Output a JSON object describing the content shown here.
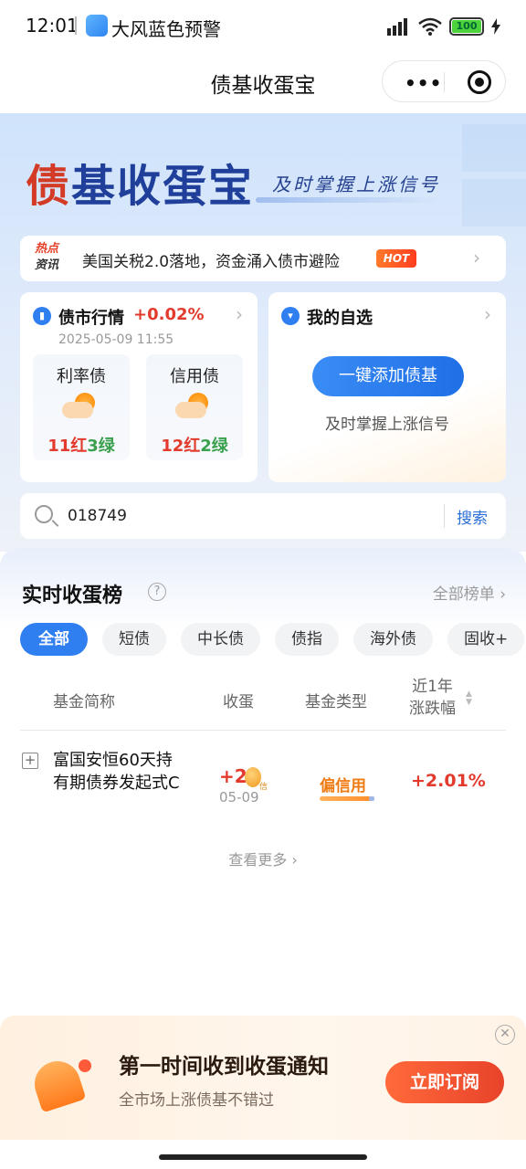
{
  "status_bar": {
    "time": "12:01",
    "app_label": "大风蓝色预警",
    "battery": "100"
  },
  "nav": {
    "title": "债基收蛋宝",
    "more_icon": "ellipsis-icon",
    "close_icon": "target-icon"
  },
  "banner": {
    "brand_title_a": "债",
    "brand_title_b": "基收蛋宝",
    "slogan": "及时掌握上涨信号"
  },
  "news": {
    "tag_line1": "热点",
    "tag_line2": "资讯",
    "text": "美国关税2.0落地，资金涌入债市避险",
    "hot_label": "HOT"
  },
  "market_card": {
    "title": "债市行情",
    "change": "+0.02%",
    "time": "2025-05-09 11:55",
    "rate": {
      "label": "利率债",
      "red": "11红",
      "green": "3绿"
    },
    "credit": {
      "label": "信用债",
      "red": "12红",
      "green": "2绿"
    }
  },
  "watch_card": {
    "title": "我的自选",
    "add_button": "一键添加债基",
    "subtitle": "及时掌握上涨信号"
  },
  "search": {
    "value": "018749",
    "button": "搜索"
  },
  "ranking": {
    "title": "实时收蛋榜",
    "all_link": "全部榜单",
    "tabs": [
      "全部",
      "短债",
      "中长债",
      "债指",
      "海外债",
      "固收+"
    ],
    "headers": {
      "name": "基金简称",
      "egg": "收蛋",
      "type": "基金类型",
      "change_line1": "近1年",
      "change_line2": "涨跌幅"
    },
    "rows": [
      {
        "name": "富国安恒60天持有期债券发起式C",
        "egg": "+2",
        "egg_sub": "信",
        "date": "05-09",
        "type": "偏信用",
        "change": "+2.01%"
      }
    ],
    "view_more": "查看更多"
  },
  "notify": {
    "title": "第一时间收到收蛋通知",
    "subtitle": "全市场上涨债基不错过",
    "button": "立即订阅"
  }
}
